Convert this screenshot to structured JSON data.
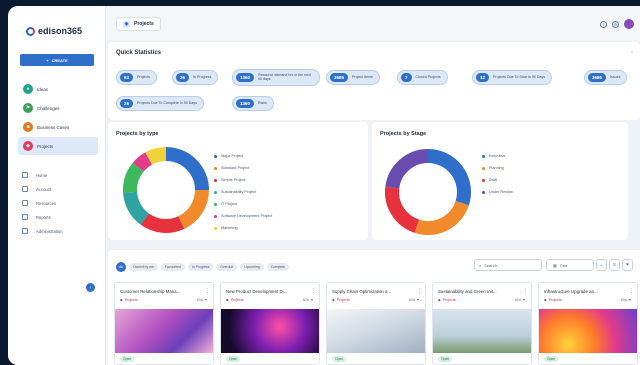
{
  "app": {
    "brand": "edison365"
  },
  "sidebar": {
    "create_label": "CREATE",
    "workspaces": [
      {
        "label": "Ideas",
        "color": "#1fa38a"
      },
      {
        "label": "Challenges",
        "color": "#3aa35a"
      },
      {
        "label": "Business Cases",
        "color": "#e27a1f"
      },
      {
        "label": "Projects",
        "color": "#e23b5c"
      }
    ],
    "menu": [
      "Home",
      "Account",
      "Resources",
      "Reports",
      "Administration"
    ]
  },
  "topbar": {
    "breadcrumb": "Projects"
  },
  "stats": {
    "title": "Quick Statistics",
    "pills": [
      {
        "num": "63",
        "label": "Projects"
      },
      {
        "num": "26",
        "label": "In Progress"
      },
      {
        "num": "1360",
        "label": "Resource demand hrs in the next 90 days"
      },
      {
        "num": "3685",
        "label": "Project items"
      },
      {
        "num": "7",
        "label": "Closed Projects"
      },
      {
        "num": "12",
        "label": "Projects Due To Start In 90 Days"
      },
      {
        "num": "3685",
        "label": "Issues"
      },
      {
        "num": "26",
        "label": "Projects Due To Complete In 90 Days"
      },
      {
        "num": "1360",
        "label": "Risks"
      }
    ]
  },
  "charts": {
    "by_type": {
      "title": "Projects by type",
      "legend": [
        "Major Project",
        "Standard Project",
        "Simple Project",
        "Sustainability Project",
        "IT Project",
        "Software Development Project",
        "Marketing"
      ],
      "colors": [
        "#2f6fc9",
        "#f08a2b",
        "#e5323c",
        "#2fa3a0",
        "#3db85c",
        "#e23b8a",
        "#f1d23a"
      ],
      "values": [
        25,
        18,
        17,
        14,
        12,
        6,
        8
      ]
    },
    "by_stage": {
      "title": "Projects by Stage",
      "legend": [
        "Executive",
        "Planning",
        "Draft",
        "Under Review"
      ],
      "colors": [
        "#2f6fc9",
        "#f08a2b",
        "#e5323c",
        "#6a4cb0"
      ],
      "values": [
        30,
        25,
        22,
        23
      ]
    }
  },
  "projects": {
    "filters": [
      "All",
      "Owned by me",
      "Favourited",
      "In Progress",
      "Overdue",
      "Upcoming",
      "Complete"
    ],
    "search_placeholder": "Search...",
    "view_label": "Grid",
    "cards": [
      {
        "title": "Customer Relationship Mana...",
        "tag": "Projects",
        "meta": "60d",
        "status": "Open"
      },
      {
        "title": "New Product Development Di...",
        "tag": "Projects",
        "meta": "60d",
        "status": "Open"
      },
      {
        "title": "Supply Chain Optimization a...",
        "tag": "Projects",
        "meta": "60d",
        "status": "Open"
      },
      {
        "title": "Sustainability and Green Init...",
        "tag": "Projects",
        "meta": "60d",
        "status": "Open"
      },
      {
        "title": "Infrastructure Upgrade an...",
        "tag": "Projects",
        "meta": "60d",
        "status": "Open"
      }
    ]
  }
}
